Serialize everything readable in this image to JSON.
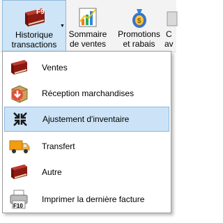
{
  "ribbon": {
    "historique": {
      "shortcut": "F9",
      "line1": "Historique",
      "line2": "transactions"
    },
    "sommaire": {
      "line1": "Sommaire",
      "line2": "de ventes"
    },
    "promotions": {
      "line1": "Promotions",
      "line2": "et rabais"
    },
    "partial": {
      "line1": "C",
      "line2": "av"
    }
  },
  "menu": {
    "items": [
      {
        "label": "Ventes",
        "icon": "book-icon"
      },
      {
        "label": "Réception marchandises",
        "icon": "box-download-icon"
      },
      {
        "label": "Ajustement d'inventaire",
        "icon": "compress-arrows-icon",
        "highlighted": true
      },
      {
        "label": "Transfert",
        "icon": "truck-icon"
      },
      {
        "label": "Autre",
        "icon": "book-icon"
      },
      {
        "label": "Imprimer la dernière facture",
        "icon": "printer-icon",
        "shortcut": "F10"
      }
    ]
  },
  "colors": {
    "highlight": "#cce3f7",
    "highlight_border": "#8ab6e2",
    "book_red": "#8b1a12"
  }
}
